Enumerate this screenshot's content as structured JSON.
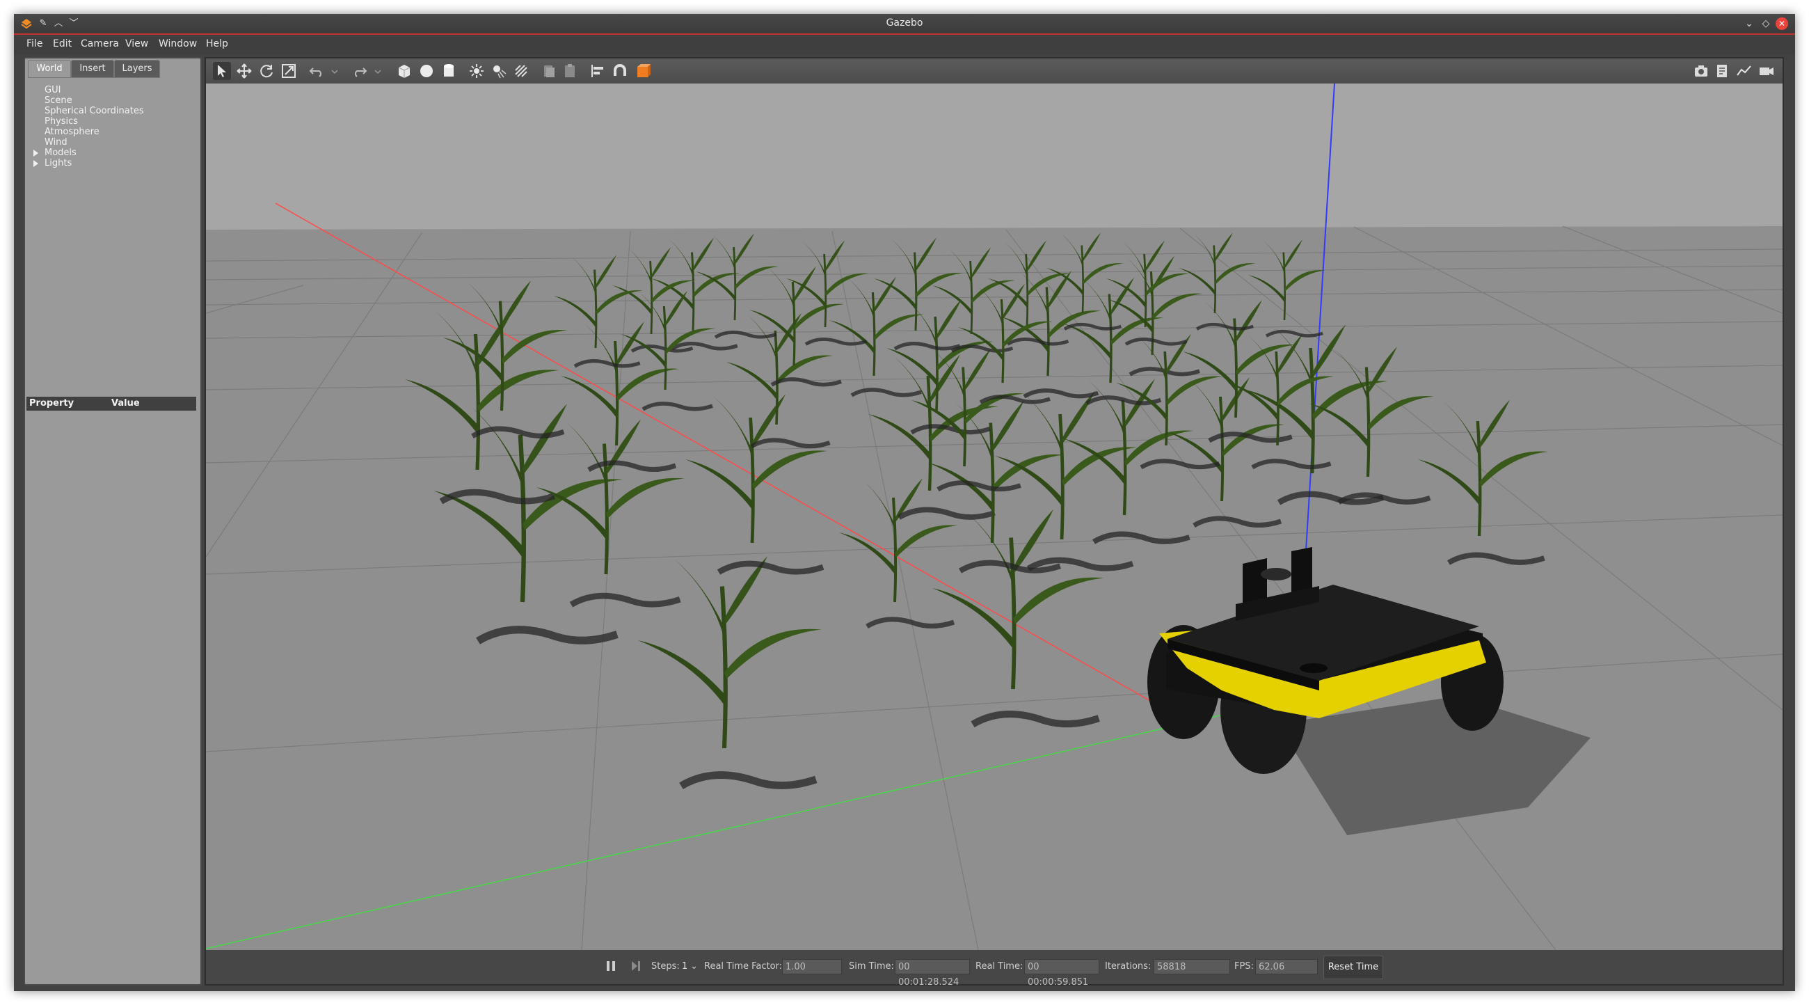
{
  "window": {
    "title": "Gazebo"
  },
  "menubar": {
    "items": [
      "File",
      "Edit",
      "Camera",
      "View",
      "Window",
      "Help"
    ]
  },
  "left_panel": {
    "tabs": [
      "World",
      "Insert",
      "Layers"
    ],
    "active_tab": "World",
    "tree": {
      "items": [
        "GUI",
        "Scene",
        "Spherical Coordinates",
        "Physics",
        "Atmosphere",
        "Wind"
      ],
      "expandable_items": [
        "Models",
        "Lights"
      ]
    },
    "properties": {
      "col_property": "Property",
      "col_value": "Value"
    }
  },
  "toolbar": {
    "tools": [
      "select-mode",
      "translate-mode",
      "rotate-mode",
      "scale-mode",
      "undo",
      "redo",
      "box-shape",
      "sphere-shape",
      "cylinder-shape",
      "point-light",
      "spot-light",
      "directional-light",
      "copy",
      "paste",
      "align",
      "snap",
      "change-view"
    ],
    "right_tools": [
      "screenshot",
      "log",
      "plot",
      "record-video"
    ]
  },
  "status": {
    "steps_label": "Steps:",
    "steps_value": "1",
    "rtf_label": "Real Time Factor:",
    "rtf_value": "1.00",
    "sim_time_label": "Sim Time:",
    "sim_time_value": "00 00:01:28.524",
    "real_time_label": "Real Time:",
    "real_time_value": "00 00:00:59.851",
    "iterations_label": "Iterations:",
    "iterations_value": "58818",
    "fps_label": "FPS:",
    "fps_value": "62.06",
    "reset_label": "Reset Time"
  },
  "colors": {
    "sky": "#a6a6a6",
    "ground": "#8f8f8f",
    "grid": "#7b7b7b",
    "robot_body": "#1e1e1e",
    "robot_bumper": "#e5d100",
    "plant": "#2f4a16",
    "axis_x": "#ff3b3b",
    "axis_y": "#3fd63f",
    "axis_z": "#2a3cff"
  }
}
